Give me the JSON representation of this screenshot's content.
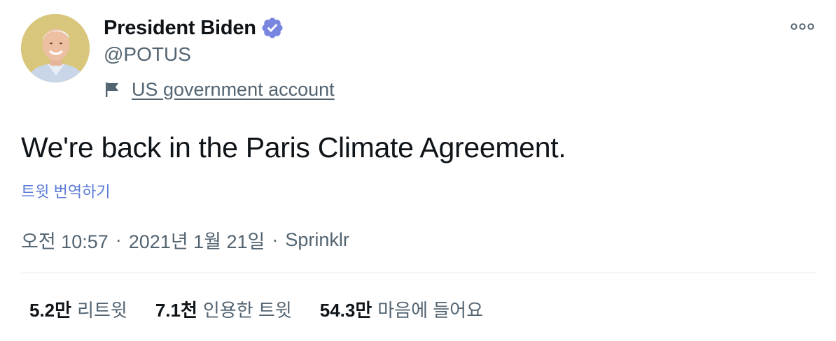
{
  "user": {
    "display_name": "President Biden",
    "handle": "@POTUS",
    "avatar_icon": "profile-photo",
    "verified_icon": "verified-badge-icon",
    "verified_color": "#7886e0",
    "account_label": "US government account"
  },
  "tweet": {
    "text": "We're back in the Paris Climate Agreement.",
    "translate_label": "트윗 번역하기",
    "time": "오전 10:57",
    "date": "2021년 1월 21일",
    "source": "Sprinklr",
    "separator": "·"
  },
  "stats": [
    {
      "count": "5.2만",
      "label": "리트윗"
    },
    {
      "count": "7.1천",
      "label": "인용한 트윗"
    },
    {
      "count": "54.3만",
      "label": "마음에 들어요"
    }
  ],
  "colors": {
    "text_primary": "#0f1419",
    "text_secondary": "#536471",
    "link_translate": "#5b7bd5",
    "divider": "#e6e9eb"
  }
}
